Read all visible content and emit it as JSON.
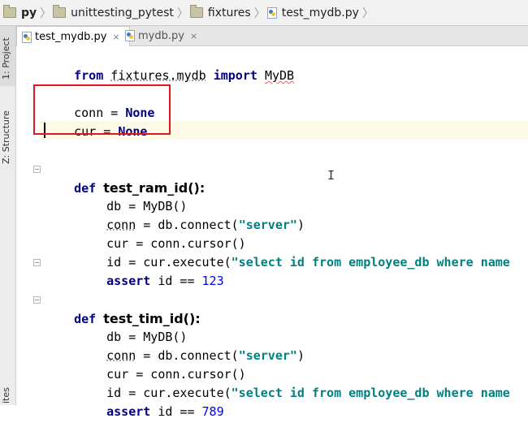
{
  "breadcrumb": {
    "items": [
      {
        "label": "py",
        "icon": "folder-icon"
      },
      {
        "label": "unittesting_pytest",
        "icon": "folder-icon"
      },
      {
        "label": "fixtures",
        "icon": "folder-icon"
      },
      {
        "label": "test_mydb.py",
        "icon": "python-file-icon"
      }
    ]
  },
  "tool_strip": {
    "project_label": "1: Project",
    "structure_label": "Z: Structure",
    "bottom_label": "ites"
  },
  "tabs": [
    {
      "label": "test_mydb.py",
      "active": true,
      "close": "×"
    },
    {
      "label": "mydb.py",
      "active": false,
      "close": "×"
    }
  ],
  "code": {
    "l1": {
      "kw1": "from",
      "mod": "fixtures.mydb",
      "kw2": "import",
      "name": "MyDB"
    },
    "l3": {
      "var": "conn",
      "op": " = ",
      "val": "None"
    },
    "l4": {
      "var": "cur",
      "op": " = ",
      "val": "None"
    },
    "f1": {
      "def": "def",
      "name": "test_ram_id():",
      "b1": "db = MyDB()",
      "b2a": "conn",
      "b2b": " = db.connect(",
      "b2s": "\"server\"",
      "b2c": ")",
      "b3": "cur = conn.cursor()",
      "b4a": "id = cur.execute(",
      "b4s": "\"select id from employee_db where name",
      "b5kw": "assert",
      "b5a": " id == ",
      "b5n": "123"
    },
    "f2": {
      "def": "def",
      "name": "test_tim_id():",
      "b1": "db = MyDB()",
      "b2a": "conn",
      "b2b": " = db.connect(",
      "b2s": "\"server\"",
      "b2c": ")",
      "b3": "cur = conn.cursor()",
      "b4a": "id = cur.execute(",
      "b4s": "\"select id from employee_db where name",
      "b5kw": "assert",
      "b5a": " id == ",
      "b5n": "789"
    }
  },
  "colors": {
    "keyword": "#000080",
    "string": "#008080",
    "number": "#0000ff",
    "highlight_box": "#e1161f",
    "current_line": "#fdfbe6"
  }
}
